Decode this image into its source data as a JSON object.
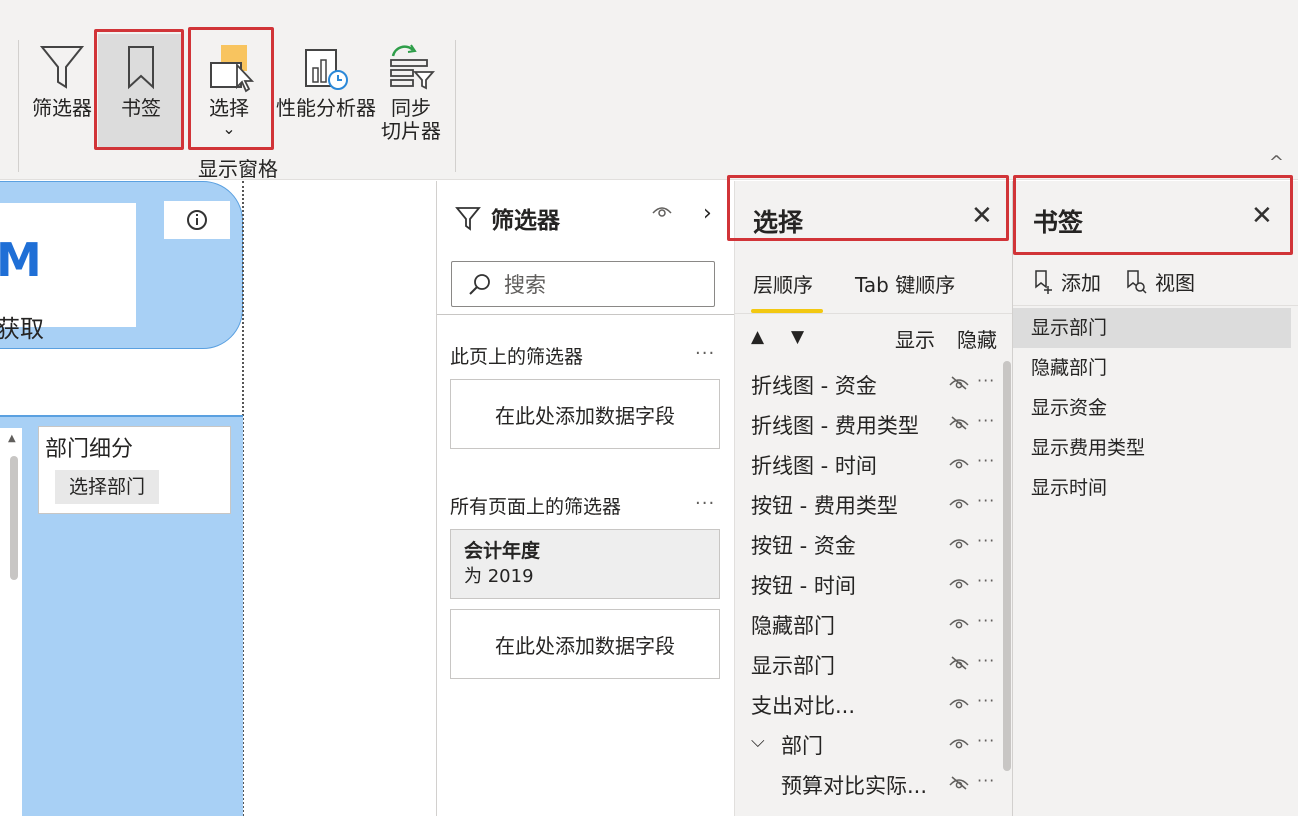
{
  "ribbon": {
    "buttons": {
      "filter": "筛选器",
      "bookmark": "书签",
      "selection": "选择",
      "performance": "性能分析器",
      "sync_line1": "同步",
      "sync_line2": "切片器"
    },
    "group_label": "显示窗格",
    "selection_chevron": "⌄",
    "collapse_caret": "^"
  },
  "canvas": {
    "card_big": "M",
    "card_sub": "获取",
    "dept_title": "部门细分",
    "dept_button": "选择部门"
  },
  "filter_pane": {
    "title": "筛选器",
    "search_placeholder": "搜索",
    "section_page": "此页上的筛选器",
    "add_field": "在此处添加数据字段",
    "section_all": "所有页面上的筛选器",
    "fiscal_year_title": "会计年度",
    "fiscal_year_value": "为 2019",
    "more": "···"
  },
  "selection_pane": {
    "title": "选择",
    "close": "✕",
    "tabs": [
      "层顺序",
      "Tab 键顺序"
    ],
    "col_show": "显示",
    "col_hide": "隐藏",
    "layers": [
      {
        "name": "折线图 - 资金",
        "hidden": true
      },
      {
        "name": "折线图 - 费用类型",
        "hidden": true
      },
      {
        "name": "折线图 - 时间",
        "hidden": false
      },
      {
        "name": "按钮 - 费用类型",
        "hidden": false
      },
      {
        "name": "按钮 - 资金",
        "hidden": false
      },
      {
        "name": "按钮 - 时间",
        "hidden": false
      },
      {
        "name": "隐藏部门",
        "hidden": false
      },
      {
        "name": "显示部门",
        "hidden": true
      },
      {
        "name": "支出对比...",
        "hidden": false
      },
      {
        "name": "部门",
        "hidden": false,
        "group": true
      },
      {
        "name": "预算对比实际...",
        "hidden": true,
        "child": true
      }
    ]
  },
  "bookmark_pane": {
    "title": "书签",
    "close": "✕",
    "add": "添加",
    "view": "视图",
    "items": [
      "显示部门",
      "隐藏部门",
      "显示资金",
      "显示费用类型",
      "显示时间"
    ],
    "active_index": 0
  },
  "colors": {
    "highlight": "#d13438",
    "card_blue": "#a8d0f5",
    "tab_underline": "#f2c811"
  }
}
